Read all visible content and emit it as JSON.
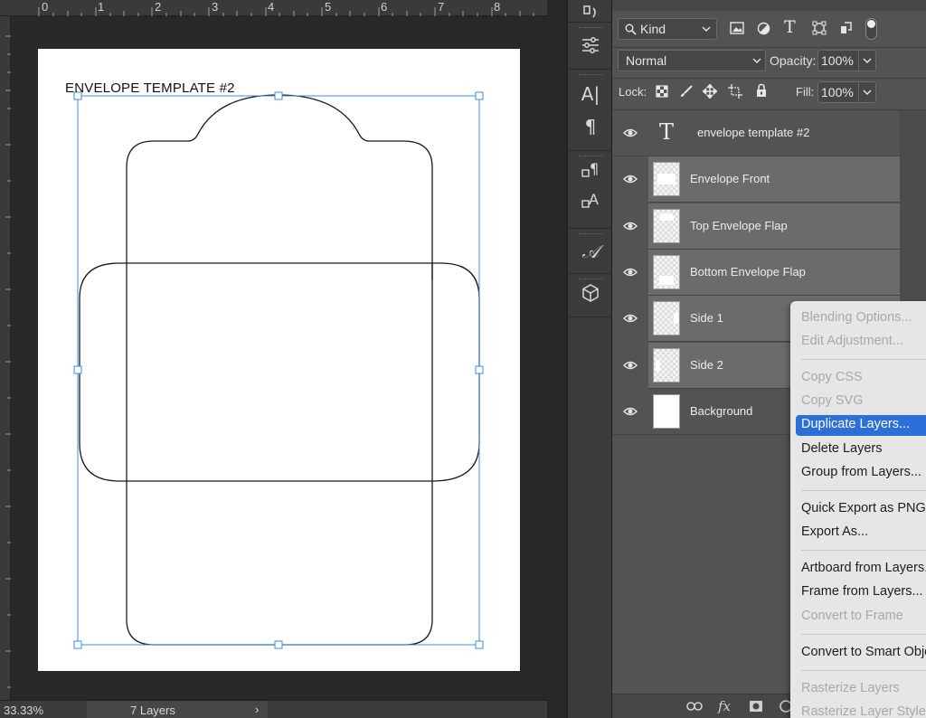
{
  "document": {
    "title_text": "ENVELOPE TEMPLATE #2",
    "ruler_numbers": [
      "0",
      "1",
      "2",
      "3",
      "4",
      "5",
      "6",
      "7",
      "8"
    ]
  },
  "status_bar": {
    "zoom": "33.33%",
    "layers_count": "7 Layers",
    "arrow": "›"
  },
  "tool_strip": {
    "icons": [
      "history-icon",
      "adjustments-icon",
      "character-icon",
      "paragraph-icon",
      "paragraph-styles-icon",
      "character-styles-icon",
      "glyphs-icon",
      "3d-icon"
    ],
    "glyph_char": "A|",
    "glyph_para": "¶",
    "glyph_script": "𝒜"
  },
  "layers_panel": {
    "filter_label": "Kind",
    "blend_mode": "Normal",
    "opacity_label": "Opacity:",
    "opacity_value": "100%",
    "lock_label": "Lock:",
    "fill_label": "Fill:",
    "fill_value": "100%",
    "type_glyph": "T",
    "layers": [
      {
        "name": "envelope template #2",
        "kind": "type",
        "selected": false
      },
      {
        "name": "Envelope Front",
        "kind": "pixel",
        "selected": true
      },
      {
        "name": "Top Envelope Flap",
        "kind": "pixel",
        "selected": true
      },
      {
        "name": "Bottom Envelope Flap",
        "kind": "pixel",
        "selected": true
      },
      {
        "name": "Side 1",
        "kind": "pixel",
        "selected": true
      },
      {
        "name": "Side 2",
        "kind": "pixel",
        "selected": true
      },
      {
        "name": "Background",
        "kind": "background",
        "selected": false
      }
    ],
    "bottom_icons": [
      "link-icon",
      "fx-icon",
      "mask-icon",
      "adjustment-layer-icon"
    ],
    "fx_label": "fx"
  },
  "context_menu": {
    "items": [
      {
        "label": "Blending Options...",
        "enabled": false
      },
      {
        "label": "Edit Adjustment...",
        "enabled": false
      },
      {
        "label": "Copy CSS",
        "enabled": false
      },
      {
        "label": "Copy SVG",
        "enabled": false
      },
      {
        "label": "Duplicate Layers...",
        "enabled": true,
        "highlighted": true
      },
      {
        "label": "Delete Layers",
        "enabled": true
      },
      {
        "label": "Group from Layers...",
        "enabled": true
      },
      {
        "label": "Quick Export as PNG",
        "enabled": true
      },
      {
        "label": "Export As...",
        "enabled": true
      },
      {
        "label": "Artboard from Layers...",
        "enabled": true
      },
      {
        "label": "Frame from Layers...",
        "enabled": true
      },
      {
        "label": "Convert to Frame",
        "enabled": false
      },
      {
        "label": "Convert to Smart Object",
        "enabled": true
      },
      {
        "label": "Rasterize Layers",
        "enabled": false
      },
      {
        "label": "Rasterize Layer Style",
        "enabled": false
      }
    ]
  },
  "colors": {
    "selection_blue": "#2c6fd8",
    "transform_blue": "#3b8be6",
    "panel_bg": "#535353",
    "selected_layer": "#6b6b6b"
  }
}
